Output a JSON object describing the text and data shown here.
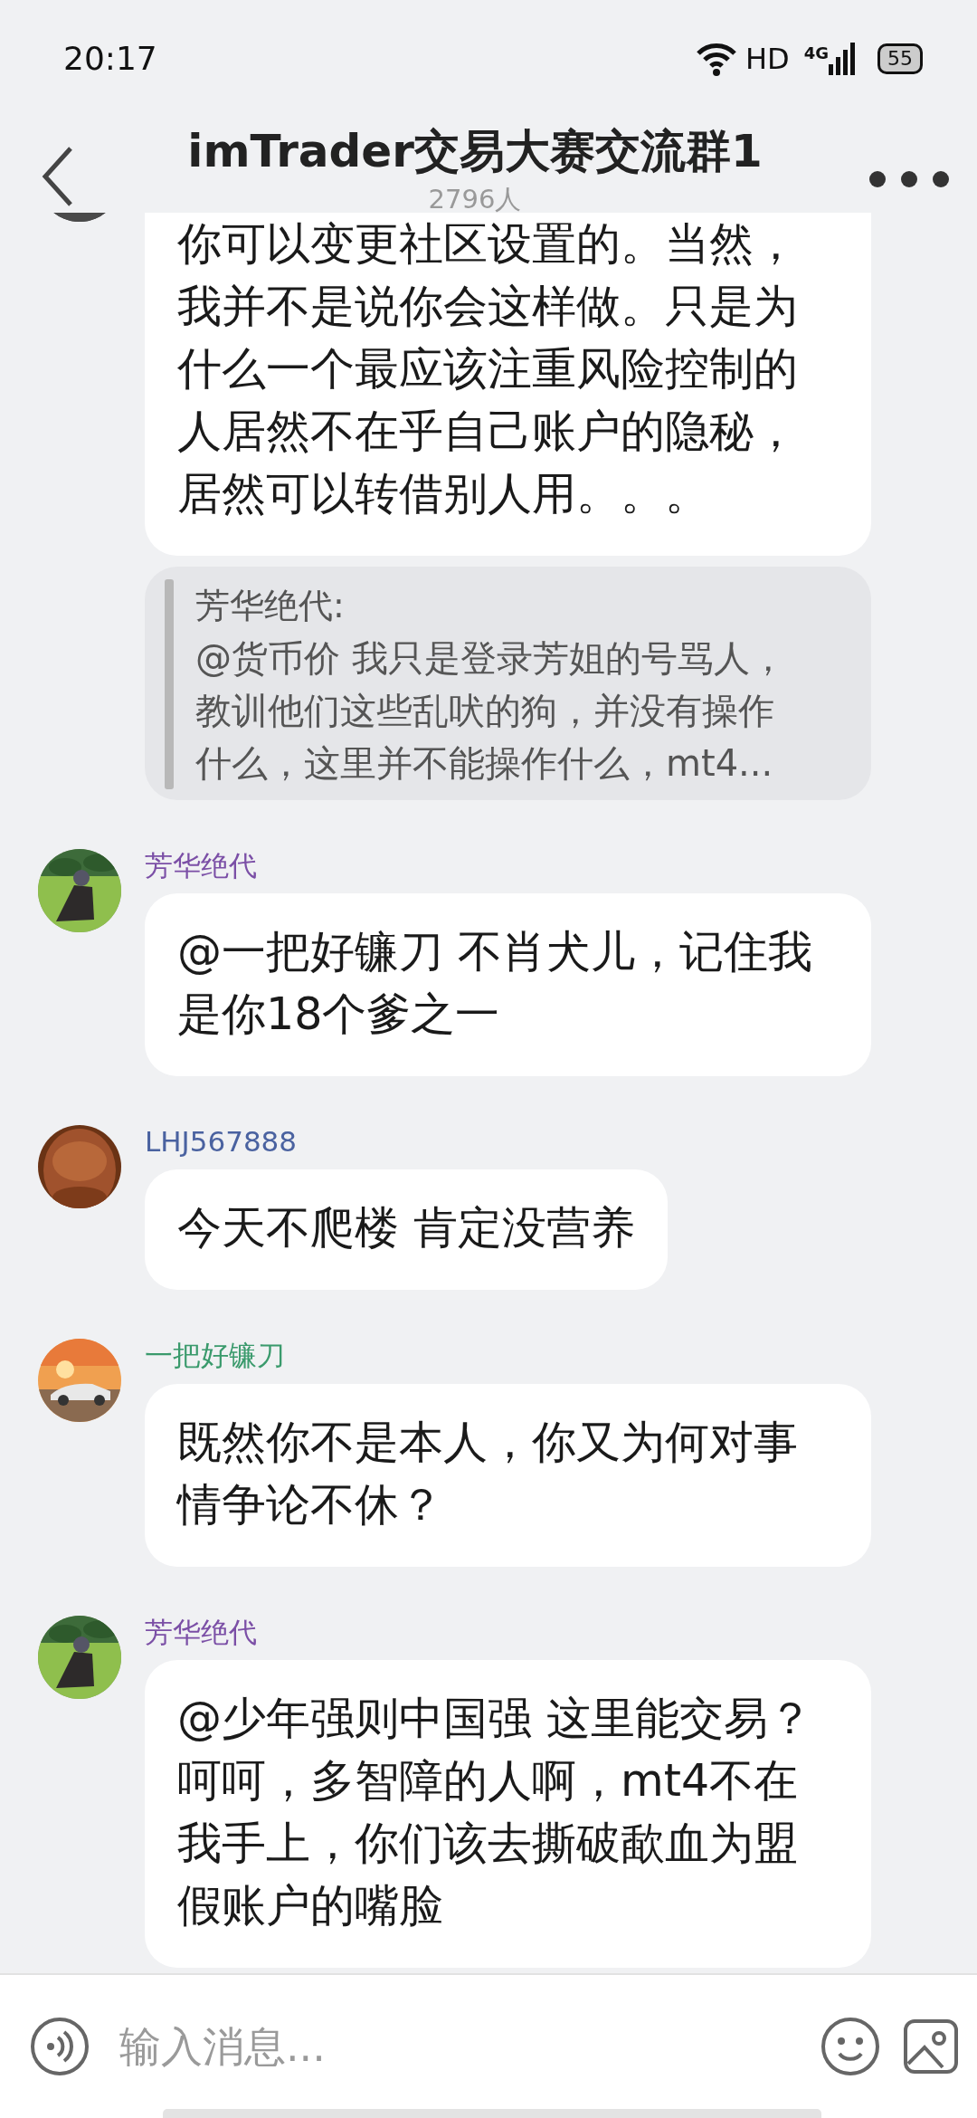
{
  "status_bar": {
    "time": "20:17",
    "hd": "HD",
    "network": "4G",
    "battery": "55"
  },
  "header": {
    "title": "imTrader交易大赛交流群1",
    "member_count": "2796人"
  },
  "messages": [
    {
      "text": "你可以变更社区设置的。当然，我并不是说你会这样做。只是为什么一个最应该注重风险控制的人居然不在乎自己账户的隐秘，居然可以转借别人用。。。",
      "quote": {
        "author": "芳华绝代:",
        "text": "@货币价 我只是登录芳姐的号骂人，教训他们这些乱吠的狗，并没有操作什么，这里并不能操作什么，mt4..."
      }
    },
    {
      "author": "芳华绝代",
      "color": "#7b4fa6",
      "text": "@一把好镰刀 不肖犬儿，记住我是你18个爹之一"
    },
    {
      "author": "LHJ567888",
      "color": "#4a62a0",
      "text": "今天不爬楼 肯定没营养"
    },
    {
      "author": "一把好镰刀",
      "color": "#3a9a6c",
      "text": "既然你不是本人，你又为何对事情争论不休？"
    },
    {
      "author": "芳华绝代",
      "color": "#7b4fa6",
      "text": "@少年强则中国强 这里能交易？呵呵，多智障的人啊，mt4不在我手上，你们该去撕破歃血为盟假账户的嘴脸"
    }
  ],
  "input": {
    "placeholder": "输入消息..."
  }
}
